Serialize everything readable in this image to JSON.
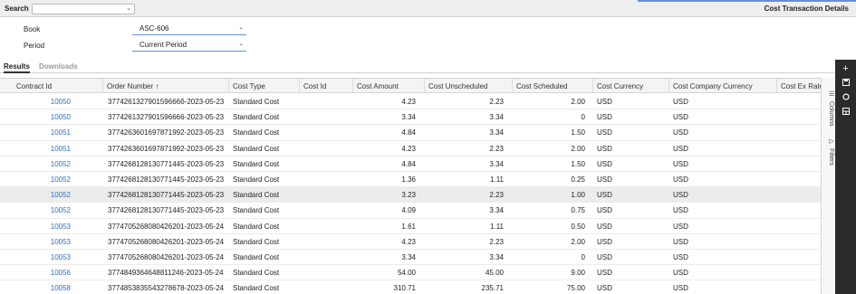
{
  "top": {
    "search_label": "Search",
    "search_value": "",
    "page_title": "Cost Transaction Details"
  },
  "form": {
    "book_label": "Book",
    "book_value": "ASC-606",
    "period_label": "Period",
    "period_value": "Current Period"
  },
  "tabs": [
    {
      "label": "Results",
      "active": true
    },
    {
      "label": "Downloads",
      "active": false
    }
  ],
  "grid": {
    "columns": [
      "Contract Id",
      "Order Number ↑",
      "Cost Type",
      "Cost Id",
      "Cost Amount",
      "Cost Unscheduled",
      "Cost Scheduled",
      "Cost Currency",
      "Cost Company Currency",
      "Cost Ex Rate"
    ],
    "rows": [
      {
        "contract_id": "10050",
        "order_number": "377426132790159666б-2023-05-23",
        "cost_type": "Standard Cost",
        "cost_id": "",
        "cost_amount": "4.23",
        "cost_unscheduled": "2.23",
        "cost_scheduled": "2.00",
        "cost_currency": "USD",
        "company_currency": "USD"
      },
      {
        "contract_id": "10050",
        "order_number": "3774261327901596666-2023-05-23",
        "cost_type": "Standard Cost",
        "cost_id": "",
        "cost_amount": "3.34",
        "cost_unscheduled": "3.34",
        "cost_scheduled": "0",
        "cost_currency": "USD",
        "company_currency": "USD"
      },
      {
        "contract_id": "10051",
        "order_number": "3774263601697871992-2023-05-23",
        "cost_type": "Standard Cost",
        "cost_id": "",
        "cost_amount": "4.84",
        "cost_unscheduled": "3.34",
        "cost_scheduled": "1.50",
        "cost_currency": "USD",
        "company_currency": "USD"
      },
      {
        "contract_id": "10051",
        "order_number": "3774263601697871992-2023-05-23",
        "cost_type": "Standard Cost",
        "cost_id": "",
        "cost_amount": "4.23",
        "cost_unscheduled": "2.23",
        "cost_scheduled": "2.00",
        "cost_currency": "USD",
        "company_currency": "USD"
      },
      {
        "contract_id": "10052",
        "order_number": "3774268128130771445-2023-05-23",
        "cost_type": "Standard Cost",
        "cost_id": "",
        "cost_amount": "4.84",
        "cost_unscheduled": "3.34",
        "cost_scheduled": "1.50",
        "cost_currency": "USD",
        "company_currency": "USD"
      },
      {
        "contract_id": "10052",
        "order_number": "3774268128130771445-2023-05-23",
        "cost_type": "Standard Cost",
        "cost_id": "",
        "cost_amount": "1.36",
        "cost_unscheduled": "1.11",
        "cost_scheduled": "0.25",
        "cost_currency": "USD",
        "company_currency": "USD"
      },
      {
        "contract_id": "10052",
        "order_number": "3774268128130771445-2023-05-23",
        "cost_type": "Standard Cost",
        "cost_id": "",
        "cost_amount": "3.23",
        "cost_unscheduled": "2.23",
        "cost_scheduled": "1.00",
        "cost_currency": "USD",
        "company_currency": "USD"
      },
      {
        "contract_id": "10052",
        "order_number": "3774268128130771445-2023-05-23",
        "cost_type": "Standard Cost",
        "cost_id": "",
        "cost_amount": "4.09",
        "cost_unscheduled": "3.34",
        "cost_scheduled": "0.75",
        "cost_currency": "USD",
        "company_currency": "USD"
      },
      {
        "contract_id": "10053",
        "order_number": "3774705268080426201-2023-05-24",
        "cost_type": "Standard Cost",
        "cost_id": "",
        "cost_amount": "1.61",
        "cost_unscheduled": "1.11",
        "cost_scheduled": "0.50",
        "cost_currency": "USD",
        "company_currency": "USD"
      },
      {
        "contract_id": "10053",
        "order_number": "3774705268080426201-2023-05-24",
        "cost_type": "Standard Cost",
        "cost_id": "",
        "cost_amount": "4.23",
        "cost_unscheduled": "2.23",
        "cost_scheduled": "2.00",
        "cost_currency": "USD",
        "company_currency": "USD"
      },
      {
        "contract_id": "10053",
        "order_number": "3774705268080426201-2023-05-24",
        "cost_type": "Standard Cost",
        "cost_id": "",
        "cost_amount": "3.34",
        "cost_unscheduled": "3.34",
        "cost_scheduled": "0",
        "cost_currency": "USD",
        "company_currency": "USD"
      },
      {
        "contract_id": "10056",
        "order_number": "3774849364648811246-2023-05-24",
        "cost_type": "Standard Cost",
        "cost_id": "",
        "cost_amount": "54.00",
        "cost_unscheduled": "45.00",
        "cost_scheduled": "9.00",
        "cost_currency": "USD",
        "company_currency": "USD"
      },
      {
        "contract_id": "10058",
        "order_number": "3774853835543278678-2023-05-24",
        "cost_type": "Standard Cost",
        "cost_id": "",
        "cost_amount": "310.71",
        "cost_unscheduled": "235.71",
        "cost_scheduled": "75.00",
        "cost_currency": "USD",
        "company_currency": "USD"
      }
    ]
  },
  "side_panel": {
    "columns_label": "Columns",
    "filters_label": "Filters"
  },
  "rail": {
    "icons": [
      "plus-icon",
      "save-icon",
      "reset-icon",
      "layout-icon"
    ]
  },
  "colors": {
    "link": "#2f6ec7",
    "accent": "#6b8fd6",
    "rail": "#2b2b2b"
  }
}
